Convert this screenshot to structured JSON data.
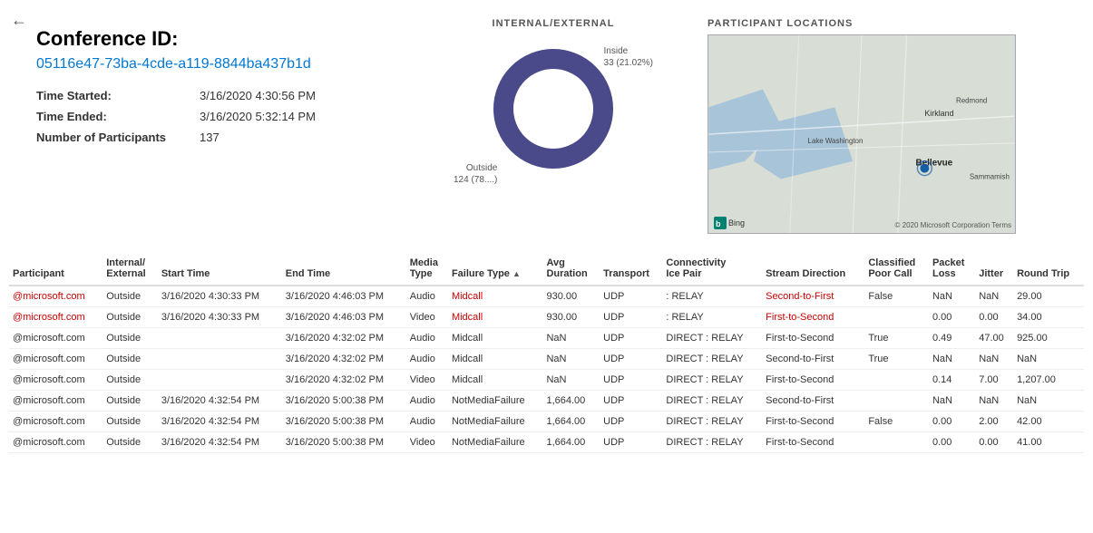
{
  "back_button": "←",
  "conf_id_label": "Conference ID:",
  "conf_id_value": "05116e47-73ba-4cde-a119-8844ba437b1d",
  "time_started_label": "Time Started:",
  "time_started_value": "3/16/2020 4:30:56 PM",
  "time_ended_label": "Time Ended:",
  "time_ended_value": "3/16/2020 5:32:14 PM",
  "num_participants_label": "Number of Participants",
  "num_participants_value": "137",
  "chart_title": "INTERNAL/EXTERNAL",
  "donut": {
    "inside_label": "Inside",
    "inside_value": "33 (21.02%)",
    "outside_label": "Outside",
    "outside_value": "124 (78....)",
    "inside_pct": 21.02,
    "outside_pct": 78.98,
    "inside_color": "#aaaacc",
    "outside_color": "#4a4a8a"
  },
  "map_title": "PARTICIPANT LOCATIONS",
  "bing_label": "Bing",
  "map_copyright": "© 2020 Microsoft Corporation Terms",
  "table": {
    "columns": [
      "Participant",
      "Internal/ External",
      "Start Time",
      "End Time",
      "Media Type",
      "Failure Type ↑",
      "Avg Duration",
      "Transport",
      "Connectivity Ice Pair",
      "Stream Direction",
      "Classified Poor Call",
      "Packet Loss",
      "Jitter",
      "Round Trip"
    ],
    "rows": [
      {
        "participant": "@microsoft.com",
        "ie": "Outside",
        "start": "3/16/2020 4:30:33 PM",
        "end": "3/16/2020 4:46:03 PM",
        "media": "Audio",
        "failure": "Midcall",
        "avg_dur": "930.00",
        "transport": "UDP",
        "ice": ": RELAY",
        "stream_dir": "Second-to-First",
        "poor_call": "False",
        "packet_loss": "NaN",
        "jitter": "NaN",
        "round_trip": "29.00",
        "highlight": "red"
      },
      {
        "participant": "@microsoft.com",
        "ie": "Outside",
        "start": "3/16/2020 4:30:33 PM",
        "end": "3/16/2020 4:46:03 PM",
        "media": "Video",
        "failure": "Midcall",
        "avg_dur": "930.00",
        "transport": "UDP",
        "ice": ": RELAY",
        "stream_dir": "First-to-Second",
        "poor_call": "",
        "packet_loss": "0.00",
        "jitter": "0.00",
        "round_trip": "34.00",
        "highlight": "red"
      },
      {
        "participant": "@microsoft.com",
        "ie": "Outside",
        "start": "",
        "end": "3/16/2020 4:32:02 PM",
        "media": "Audio",
        "failure": "Midcall",
        "avg_dur": "NaN",
        "transport": "UDP",
        "ice": "DIRECT : RELAY",
        "stream_dir": "First-to-Second",
        "poor_call": "True",
        "packet_loss": "0.49",
        "jitter": "47.00",
        "round_trip": "925.00",
        "highlight": ""
      },
      {
        "participant": "@microsoft.com",
        "ie": "Outside",
        "start": "",
        "end": "3/16/2020 4:32:02 PM",
        "media": "Audio",
        "failure": "Midcall",
        "avg_dur": "NaN",
        "transport": "UDP",
        "ice": "DIRECT : RELAY",
        "stream_dir": "Second-to-First",
        "poor_call": "True",
        "packet_loss": "NaN",
        "jitter": "NaN",
        "round_trip": "NaN",
        "highlight": ""
      },
      {
        "participant": "@microsoft.com",
        "ie": "Outside",
        "start": "",
        "end": "3/16/2020 4:32:02 PM",
        "media": "Video",
        "failure": "Midcall",
        "avg_dur": "NaN",
        "transport": "UDP",
        "ice": "DIRECT : RELAY",
        "stream_dir": "First-to-Second",
        "poor_call": "",
        "packet_loss": "0.14",
        "jitter": "7.00",
        "round_trip": "1,207.00",
        "highlight": ""
      },
      {
        "participant": "@microsoft.com",
        "ie": "Outside",
        "start": "3/16/2020 4:32:54 PM",
        "end": "3/16/2020 5:00:38 PM",
        "media": "Audio",
        "failure": "NotMediaFailure",
        "avg_dur": "1,664.00",
        "transport": "UDP",
        "ice": "DIRECT : RELAY",
        "stream_dir": "Second-to-First",
        "poor_call": "",
        "packet_loss": "NaN",
        "jitter": "NaN",
        "round_trip": "NaN",
        "highlight": ""
      },
      {
        "participant": "@microsoft.com",
        "ie": "Outside",
        "start": "3/16/2020 4:32:54 PM",
        "end": "3/16/2020 5:00:38 PM",
        "media": "Audio",
        "failure": "NotMediaFailure",
        "avg_dur": "1,664.00",
        "transport": "UDP",
        "ice": "DIRECT : RELAY",
        "stream_dir": "First-to-Second",
        "poor_call": "False",
        "packet_loss": "0.00",
        "jitter": "2.00",
        "round_trip": "42.00",
        "highlight": ""
      },
      {
        "participant": "@microsoft.com",
        "ie": "Outside",
        "start": "3/16/2020 4:32:54 PM",
        "end": "3/16/2020 5:00:38 PM",
        "media": "Video",
        "failure": "NotMediaFailure",
        "avg_dur": "1,664.00",
        "transport": "UDP",
        "ice": "DIRECT : RELAY",
        "stream_dir": "First-to-Second",
        "poor_call": "",
        "packet_loss": "0.00",
        "jitter": "0.00",
        "round_trip": "41.00",
        "highlight": ""
      }
    ]
  }
}
